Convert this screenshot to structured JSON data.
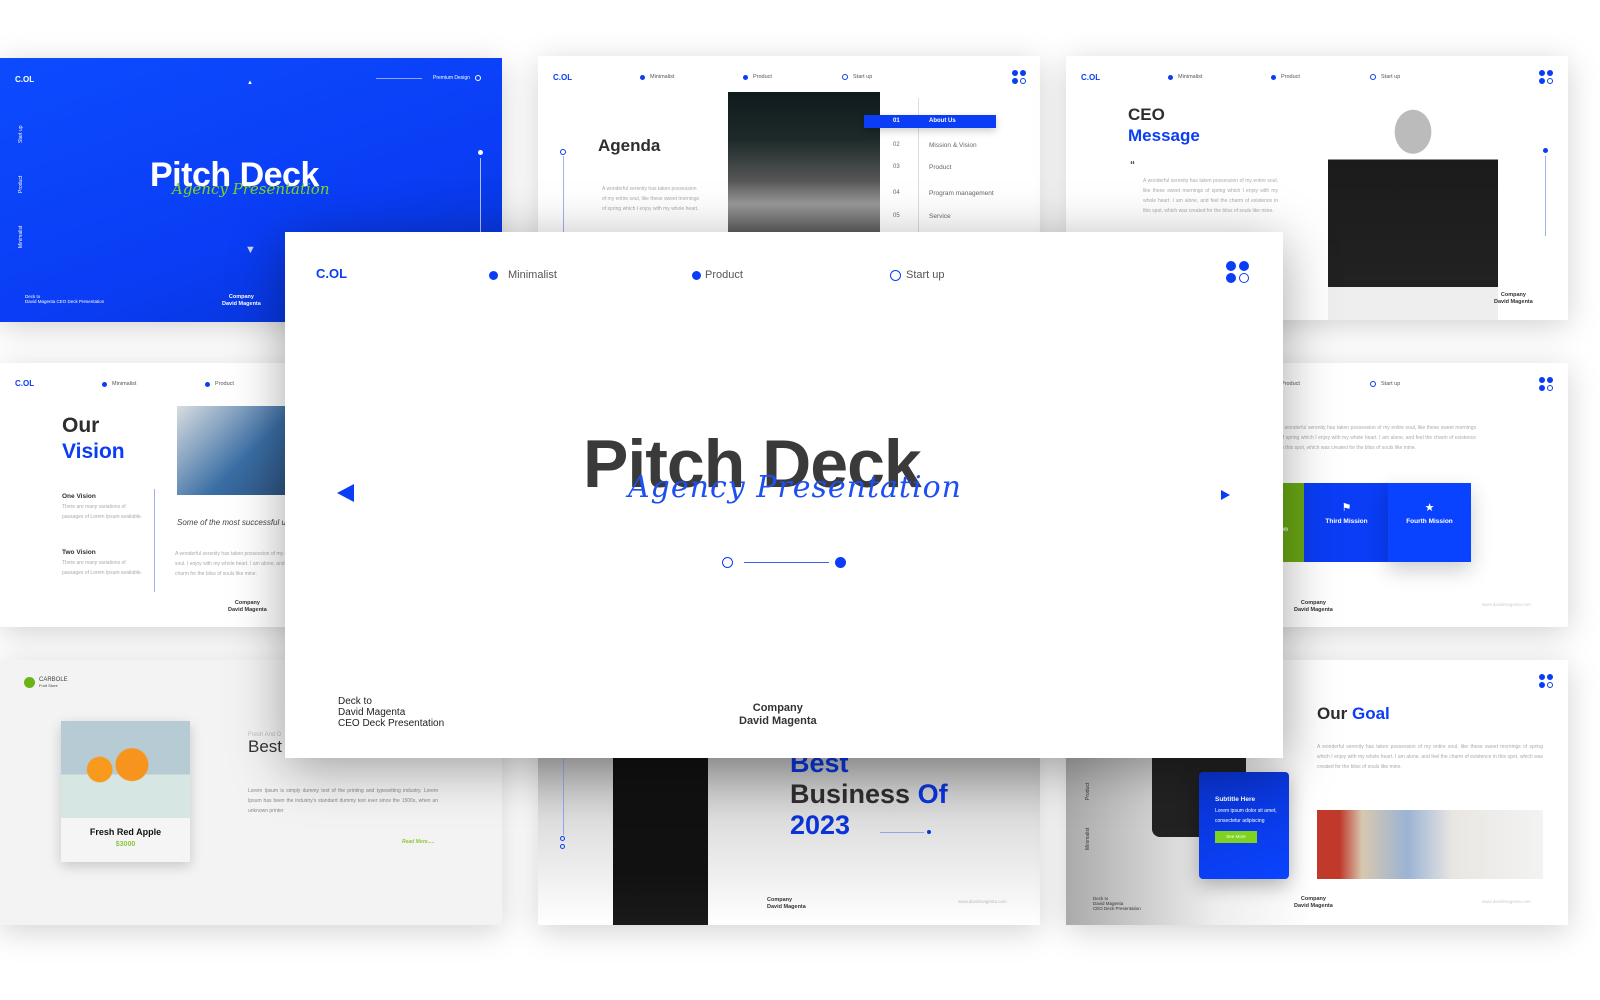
{
  "colors": {
    "accent": "#0a3df5",
    "green": "#6ab417",
    "dark": "#2e2e2e"
  },
  "brand": "C.OL",
  "nav": {
    "minimalist": "Minimalist",
    "product": "Product",
    "startup": "Start up"
  },
  "company": {
    "label": "Company",
    "name": "David Magenta"
  },
  "website": "www.davidmagenta.com",
  "deck_to": {
    "line1": "Deck to",
    "line2": "David Magenta",
    "line3": "CEO Deck Presentation",
    "single": "David Magenta CEO Deck Presentation"
  },
  "main": {
    "title": "Pitch Deck",
    "script": "Agency Presentation",
    "prev_icon": "triangle-left",
    "next_icon": "triangle-right"
  },
  "cover": {
    "premium": "Premium Design",
    "title": "Pitch Deck",
    "script": "Agency Presentation"
  },
  "agenda": {
    "title": "Agenda",
    "text": "A wonderful serenity has taken possession of my entire soul, like these sweet mornings of spring which I enjoy with my whole heart.",
    "items": [
      {
        "num": "01",
        "label": "About Us"
      },
      {
        "num": "02",
        "label": "Mission & Vision"
      },
      {
        "num": "03",
        "label": "Product"
      },
      {
        "num": "04",
        "label": "Program management"
      },
      {
        "num": "05",
        "label": "Service"
      }
    ]
  },
  "ceo": {
    "title1": "CEO",
    "title2": "Message",
    "quote": "“",
    "text": "A wonderful serenity has taken possession of my entire soul, like these sweet mornings of spring which I enjoy with my whole heart. I am alone, and feel the charm of existence in this spot, which was created for the bliss of souls like mine."
  },
  "vision": {
    "title1": "Our",
    "title2": "Vision",
    "items": [
      {
        "title": "One Vision",
        "text": "There are many variations of passages of Lorem Ipsum available."
      },
      {
        "title": "Two Vision",
        "text": "There are many variations of passages of Lorem Ipsum available."
      }
    ],
    "quote": "Some of the most successful users.",
    "text": "A wonderful serenity has taken possession of my entire soul. I enjoy with my whole heart. I am alone, and feel the charm for the bliss of souls like mine."
  },
  "mission": {
    "text": "A wonderful serenity has taken possession of my entire soul, like these sweet mornings of spring which I enjoy with my whole heart. I am alone, and feel the charm of existence in this spot, which was created for the bliss of souls like mine.",
    "partial": "on",
    "third": "Third Mission",
    "fourth": "Fourth Mission"
  },
  "fruit": {
    "brand": "CARBOLE",
    "sub": "Fruit Store",
    "product": "Fresh Red Apple",
    "price": "$3000",
    "kicker": "Fresh And D",
    "heading": "Best",
    "text": "Lorem Ipsum is simply dummy text of the printing and typesetting industry. Lorem Ipsum has been the industry's standard dummy text ever since the 1500s, when an unknown printer",
    "read_more": "Read More....."
  },
  "business": {
    "line1": "Best",
    "line2a": "Business",
    "line2b": "Of",
    "line3": "2023"
  },
  "goal": {
    "title1": "Our",
    "title2": "Goal",
    "text": "A wonderful serenity has taken possession of my entire soul, like these sweet mornings of spring which I enjoy with my whole heart. I am alone, and feel the charm of existence in this spot, which was created for the bliss of souls like mine.",
    "card_title": "Subtitle Here",
    "card_text": "Lorem ipsum dolor sit amet, consectetur adipiscing",
    "card_button": "See More"
  }
}
